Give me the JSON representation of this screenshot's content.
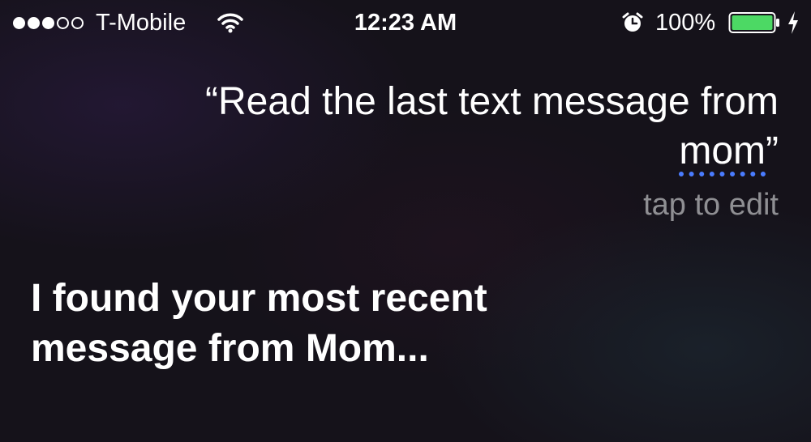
{
  "status_bar": {
    "signal_strength": "3 of 5",
    "carrier": "T-Mobile",
    "time": "12:23 AM",
    "battery_percent": "100%",
    "icons": [
      "signal-dots",
      "wifi-icon",
      "alarm-icon",
      "battery-icon",
      "charging-bolt-icon"
    ]
  },
  "siri": {
    "query_open": "“Read the last text message from ",
    "query_word": "mom",
    "query_close": "”",
    "tap_to_edit": "tap to edit",
    "response": "I found your most recent message from Mom..."
  },
  "colors": {
    "background": "#15121a",
    "text": "#ffffff",
    "secondary_text": "#8f8f93",
    "battery_fill": "#4cd964",
    "underline_accent": "#4a7cff"
  }
}
